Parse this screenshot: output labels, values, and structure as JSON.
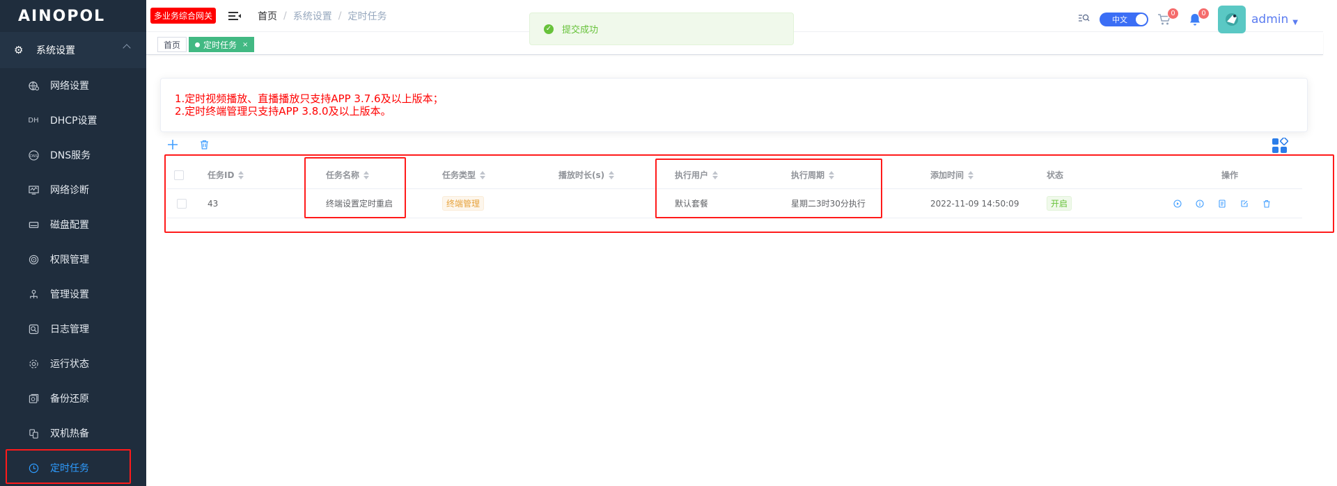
{
  "logo": "AINOPOL",
  "sidebar": {
    "section": "系统设置",
    "items": [
      {
        "label": "网络设置",
        "icon": "globe-settings-icon"
      },
      {
        "label": "DHCP设置",
        "icon": "dhcp-icon",
        "icon_text": "DH"
      },
      {
        "label": "DNS服务",
        "icon": "dns-icon"
      },
      {
        "label": "网络诊断",
        "icon": "diagnosis-icon"
      },
      {
        "label": "磁盘配置",
        "icon": "disk-icon"
      },
      {
        "label": "权限管理",
        "icon": "permission-icon"
      },
      {
        "label": "管理设置",
        "icon": "manage-icon"
      },
      {
        "label": "日志管理",
        "icon": "log-icon"
      },
      {
        "label": "运行状态",
        "icon": "status-icon"
      },
      {
        "label": "备份还原",
        "icon": "backup-icon"
      },
      {
        "label": "双机热备",
        "icon": "hot-standby-icon"
      },
      {
        "label": "定时任务",
        "icon": "clock-icon",
        "active": true
      }
    ]
  },
  "header": {
    "gateway_badge": "多业务综合网关",
    "breadcrumb": [
      "首页",
      "系统设置",
      "定时任务"
    ],
    "lang": "中文",
    "cart_count": "0",
    "bell_count": "0",
    "username": "admin"
  },
  "toast": {
    "message": "提交成功"
  },
  "tags": [
    {
      "label": "首页",
      "active": false
    },
    {
      "label": "定时任务",
      "active": true,
      "close": "×"
    }
  ],
  "notice": {
    "line1": "1.定时视频播放、直播播放只支持APP 3.7.6及以上版本；",
    "line2": "2.定时终端管理只支持APP 3.8.0及以上版本。"
  },
  "table": {
    "columns": [
      "任务ID",
      "任务名称",
      "任务类型",
      "播放时长(s)",
      "执行用户",
      "执行周期",
      "添加时间",
      "状态",
      "操作"
    ],
    "rows": [
      {
        "id": "43",
        "name": "终端设置定时重启",
        "type": "终端管理",
        "duration": "",
        "user": "默认套餐",
        "cycle": "星期二3时30分执行",
        "added": "2022-11-09 14:50:09",
        "status": "开启"
      }
    ]
  },
  "colors": {
    "sidebar_bg": "#1f2d3d",
    "active": "#2e9cff",
    "tag_green": "#42b983",
    "highlight_red": "#ff1a1a",
    "notice_red": "#ff0000"
  }
}
